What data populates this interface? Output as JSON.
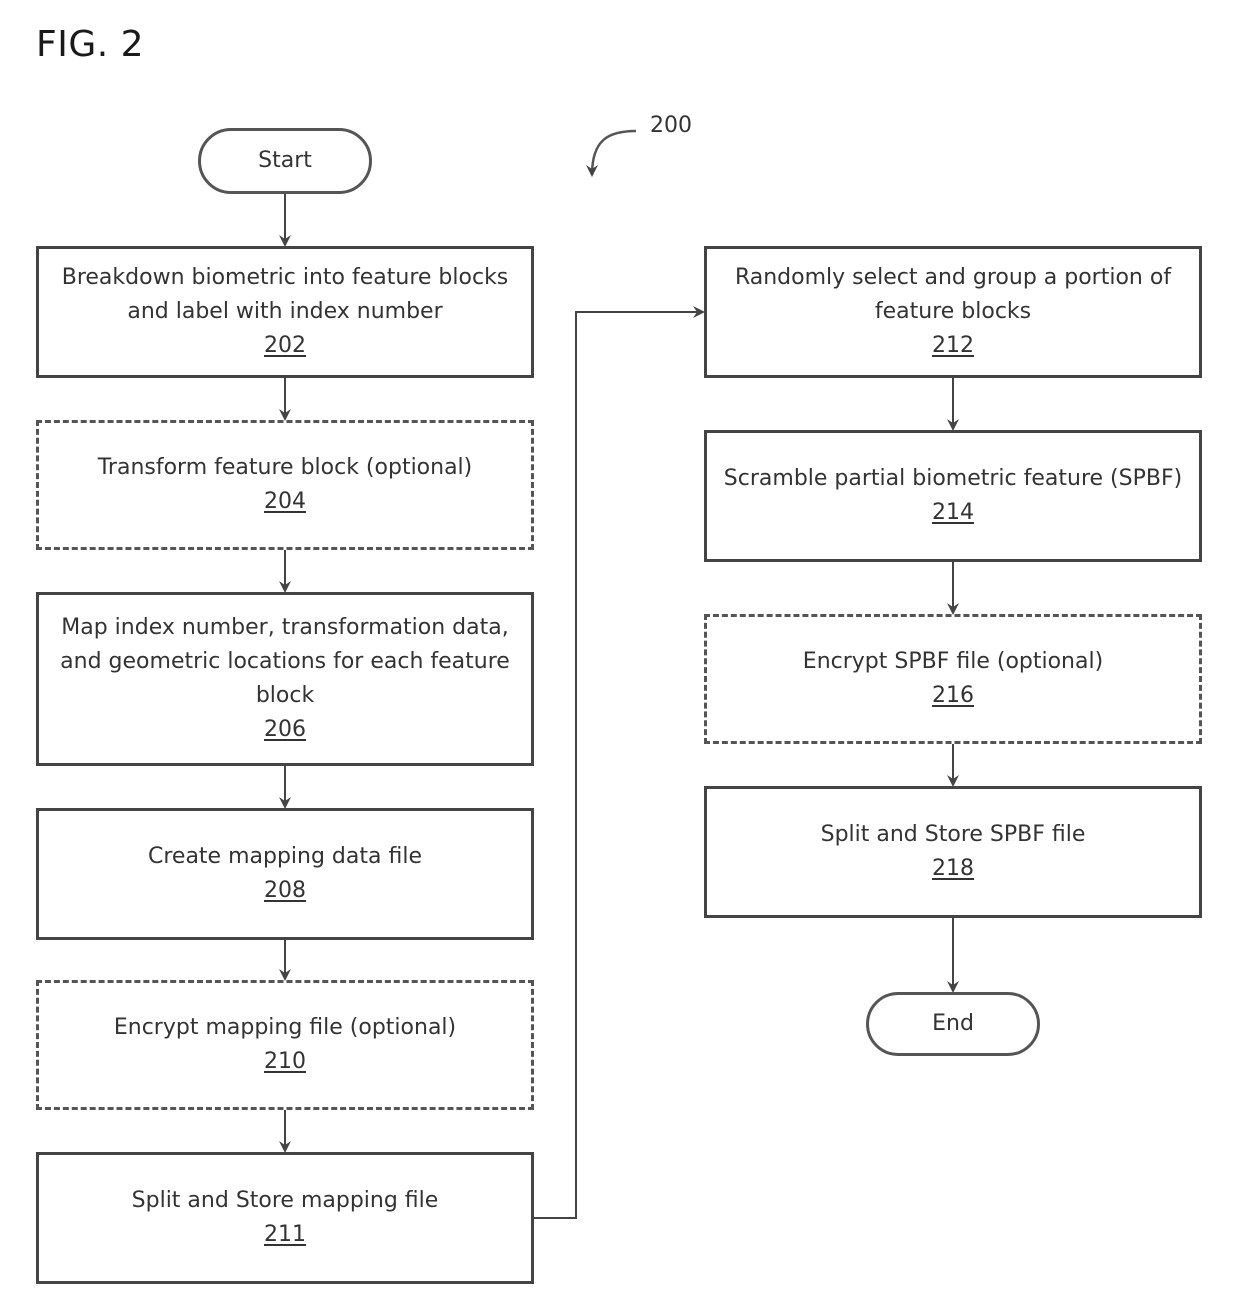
{
  "figure": {
    "title": "FIG. 2",
    "reference": "200"
  },
  "nodes": {
    "start": {
      "label": "Start"
    },
    "n202": {
      "label": "Breakdown biometric into feature blocks and label with index number",
      "ref": "202",
      "style": "solid"
    },
    "n204": {
      "label": "Transform feature block (optional)",
      "ref": "204",
      "style": "dashed"
    },
    "n206": {
      "label": "Map index number, transformation data, and geometric locations for each feature block",
      "ref": "206",
      "style": "solid"
    },
    "n208": {
      "label": "Create mapping data file",
      "ref": "208",
      "style": "solid"
    },
    "n210": {
      "label": "Encrypt mapping file (optional)",
      "ref": "210",
      "style": "dashed"
    },
    "n211": {
      "label": "Split and Store mapping file",
      "ref": "211",
      "style": "solid"
    },
    "n212": {
      "label": "Randomly select and group a portion of feature blocks",
      "ref": "212",
      "style": "solid"
    },
    "n214": {
      "label": "Scramble partial biometric feature (SPBF)",
      "ref": "214",
      "style": "solid"
    },
    "n216": {
      "label": "Encrypt SPBF file (optional)",
      "ref": "216",
      "style": "dashed"
    },
    "n218": {
      "label": "Split and Store SPBF file",
      "ref": "218",
      "style": "solid"
    },
    "end": {
      "label": "End"
    }
  },
  "edges": [
    [
      "start",
      "n202"
    ],
    [
      "n202",
      "n204"
    ],
    [
      "n204",
      "n206"
    ],
    [
      "n206",
      "n208"
    ],
    [
      "n208",
      "n210"
    ],
    [
      "n210",
      "n211"
    ],
    [
      "n211",
      "n212"
    ],
    [
      "n212",
      "n214"
    ],
    [
      "n214",
      "n216"
    ],
    [
      "n216",
      "n218"
    ],
    [
      "n218",
      "end"
    ]
  ]
}
